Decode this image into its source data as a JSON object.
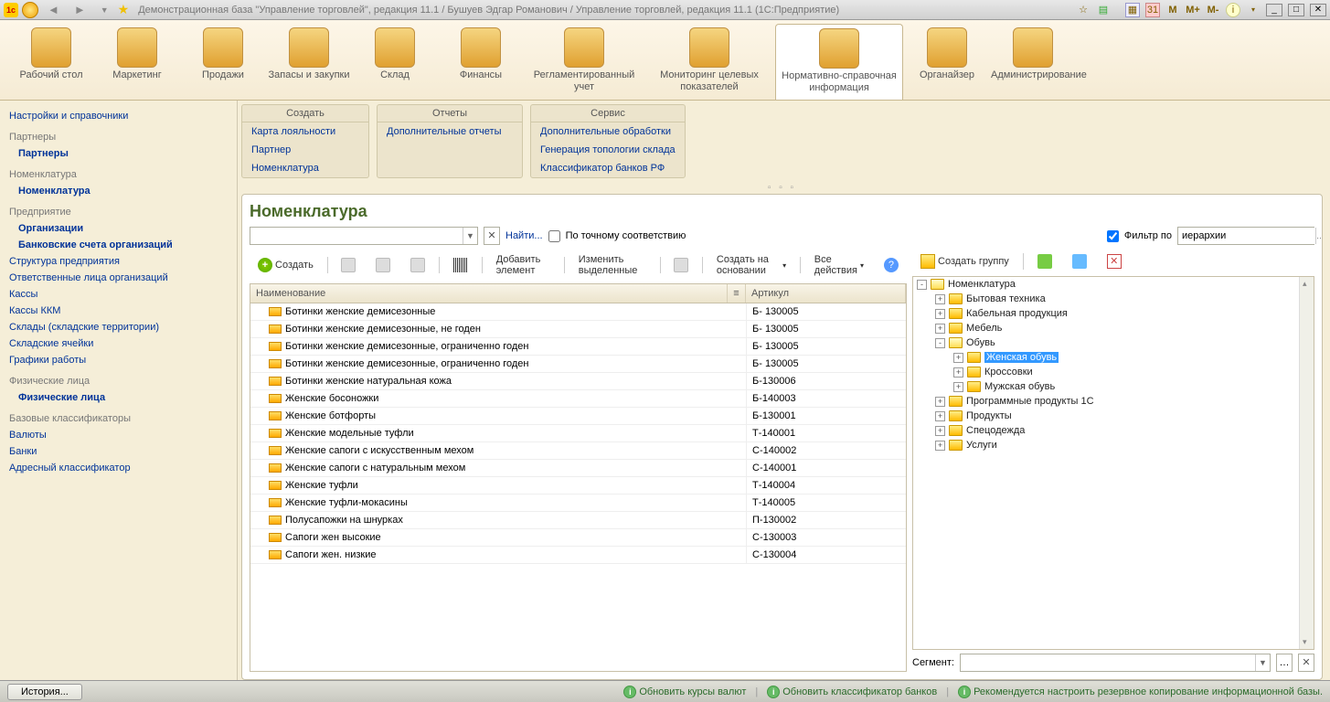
{
  "titlebar": {
    "title": "Демонстрационная база \"Управление торговлей\", редакция 11.1 / Бушуев Эдгар Романович / Управление торговлей, редакция 11.1  (1С:Предприятие)",
    "m_buttons": [
      "M",
      "M+",
      "M-"
    ]
  },
  "sections": [
    {
      "label": "Рабочий стол"
    },
    {
      "label": "Маркетинг"
    },
    {
      "label": "Продажи"
    },
    {
      "label": "Запасы и закупки"
    },
    {
      "label": "Склад"
    },
    {
      "label": "Финансы"
    },
    {
      "label": "Регламентированный учет"
    },
    {
      "label": "Мониторинг целевых показателей"
    },
    {
      "label": "Нормативно-справочная информация"
    },
    {
      "label": "Органайзер"
    },
    {
      "label": "Администрирование"
    }
  ],
  "sidebar": {
    "top_link": "Настройки и справочники",
    "groups": [
      {
        "title": "Партнеры",
        "items": [
          {
            "label": "Партнеры",
            "bold": true
          }
        ]
      },
      {
        "title": "Номенклатура",
        "items": [
          {
            "label": "Номенклатура",
            "bold": true
          }
        ]
      },
      {
        "title": "Предприятие",
        "items": [
          {
            "label": "Организации",
            "bold": true
          },
          {
            "label": "Банковские счета организаций",
            "bold": true
          },
          {
            "label": "Структура предприятия"
          },
          {
            "label": "Ответственные лица организаций"
          },
          {
            "label": "Кассы"
          },
          {
            "label": "Кассы ККМ"
          },
          {
            "label": "Склады (складские территории)"
          },
          {
            "label": "Складские ячейки"
          },
          {
            "label": "Графики работы"
          }
        ]
      },
      {
        "title": "Физические лица",
        "items": [
          {
            "label": "Физические лица",
            "bold": true
          }
        ]
      },
      {
        "title": "Базовые классификаторы",
        "items": [
          {
            "label": "Валюты"
          },
          {
            "label": "Банки"
          },
          {
            "label": "Адресный классификатор"
          }
        ]
      }
    ]
  },
  "cmd_panels": [
    {
      "title": "Создать",
      "items": [
        "Карта лояльности",
        "Партнер",
        "Номенклатура"
      ]
    },
    {
      "title": "Отчеты",
      "items": [
        "Дополнительные отчеты"
      ]
    },
    {
      "title": "Сервис",
      "items": [
        "Дополнительные обработки",
        "Генерация топологии склада",
        "Классификатор банков РФ"
      ]
    }
  ],
  "main": {
    "title": "Номенклатура",
    "find_label": "Найти...",
    "exact_match": "По точному соответствию",
    "filter_by": "Фильтр по",
    "filter_value": "иерархии",
    "toolbar": {
      "create": "Создать",
      "add_element": "Добавить элемент",
      "edit_selected": "Изменить выделенные",
      "create_based": "Создать на основании",
      "all_actions": "Все действия"
    },
    "right_toolbar": {
      "create_group": "Создать группу"
    },
    "grid": {
      "col_name": "Наименование",
      "col_article": "Артикул",
      "rows": [
        {
          "name": "Ботинки женские демисезонные",
          "art": "Б- 130005"
        },
        {
          "name": "Ботинки женские демисезонные, не годен",
          "art": "Б- 130005"
        },
        {
          "name": "Ботинки женские демисезонные, ограниченно годен",
          "art": "Б- 130005"
        },
        {
          "name": "Ботинки женские демисезонные, ограниченно годен",
          "art": "Б- 130005"
        },
        {
          "name": "Ботинки женские натуральная кожа",
          "art": "Б-130006"
        },
        {
          "name": "Женские босоножки",
          "art": "Б-140003"
        },
        {
          "name": "Женские ботфорты",
          "art": "Б-130001"
        },
        {
          "name": "Женские модельные туфли",
          "art": "Т-140001"
        },
        {
          "name": "Женские сапоги с искусственным мехом",
          "art": "С-140002"
        },
        {
          "name": "Женские сапоги с натуральным мехом",
          "art": "С-140001"
        },
        {
          "name": "Женские туфли",
          "art": "Т-140004"
        },
        {
          "name": "Женские туфли-мокасины",
          "art": "Т-140005"
        },
        {
          "name": "Полусапожки на шнурках",
          "art": "П-130002"
        },
        {
          "name": "Сапоги жен высокие",
          "art": "С-130003"
        },
        {
          "name": "Сапоги жен. низкие",
          "art": "С-130004"
        }
      ]
    },
    "tree": [
      {
        "label": "Номенклатура",
        "level": 0,
        "open": true,
        "toggle": "-"
      },
      {
        "label": "Бытовая техника",
        "level": 1,
        "toggle": "+"
      },
      {
        "label": "Кабельная продукция",
        "level": 1,
        "toggle": "+"
      },
      {
        "label": "Мебель",
        "level": 1,
        "toggle": "+"
      },
      {
        "label": "Обувь",
        "level": 1,
        "open": true,
        "toggle": "-"
      },
      {
        "label": "Женская обувь",
        "level": 2,
        "toggle": "+",
        "selected": true
      },
      {
        "label": "Кроссовки",
        "level": 2,
        "toggle": "+"
      },
      {
        "label": "Мужская обувь",
        "level": 2,
        "toggle": "+"
      },
      {
        "label": "Программные продукты 1С",
        "level": 1,
        "toggle": "+"
      },
      {
        "label": "Продукты",
        "level": 1,
        "toggle": "+"
      },
      {
        "label": "Спецодежда",
        "level": 1,
        "toggle": "+"
      },
      {
        "label": "Услуги",
        "level": 1,
        "toggle": "+"
      }
    ],
    "segment_label": "Сегмент:"
  },
  "statusbar": {
    "history": "История...",
    "links": [
      "Обновить курсы валют",
      "Обновить классификатор банков",
      "Рекомендуется настроить резервное копирование информационной базы."
    ]
  }
}
